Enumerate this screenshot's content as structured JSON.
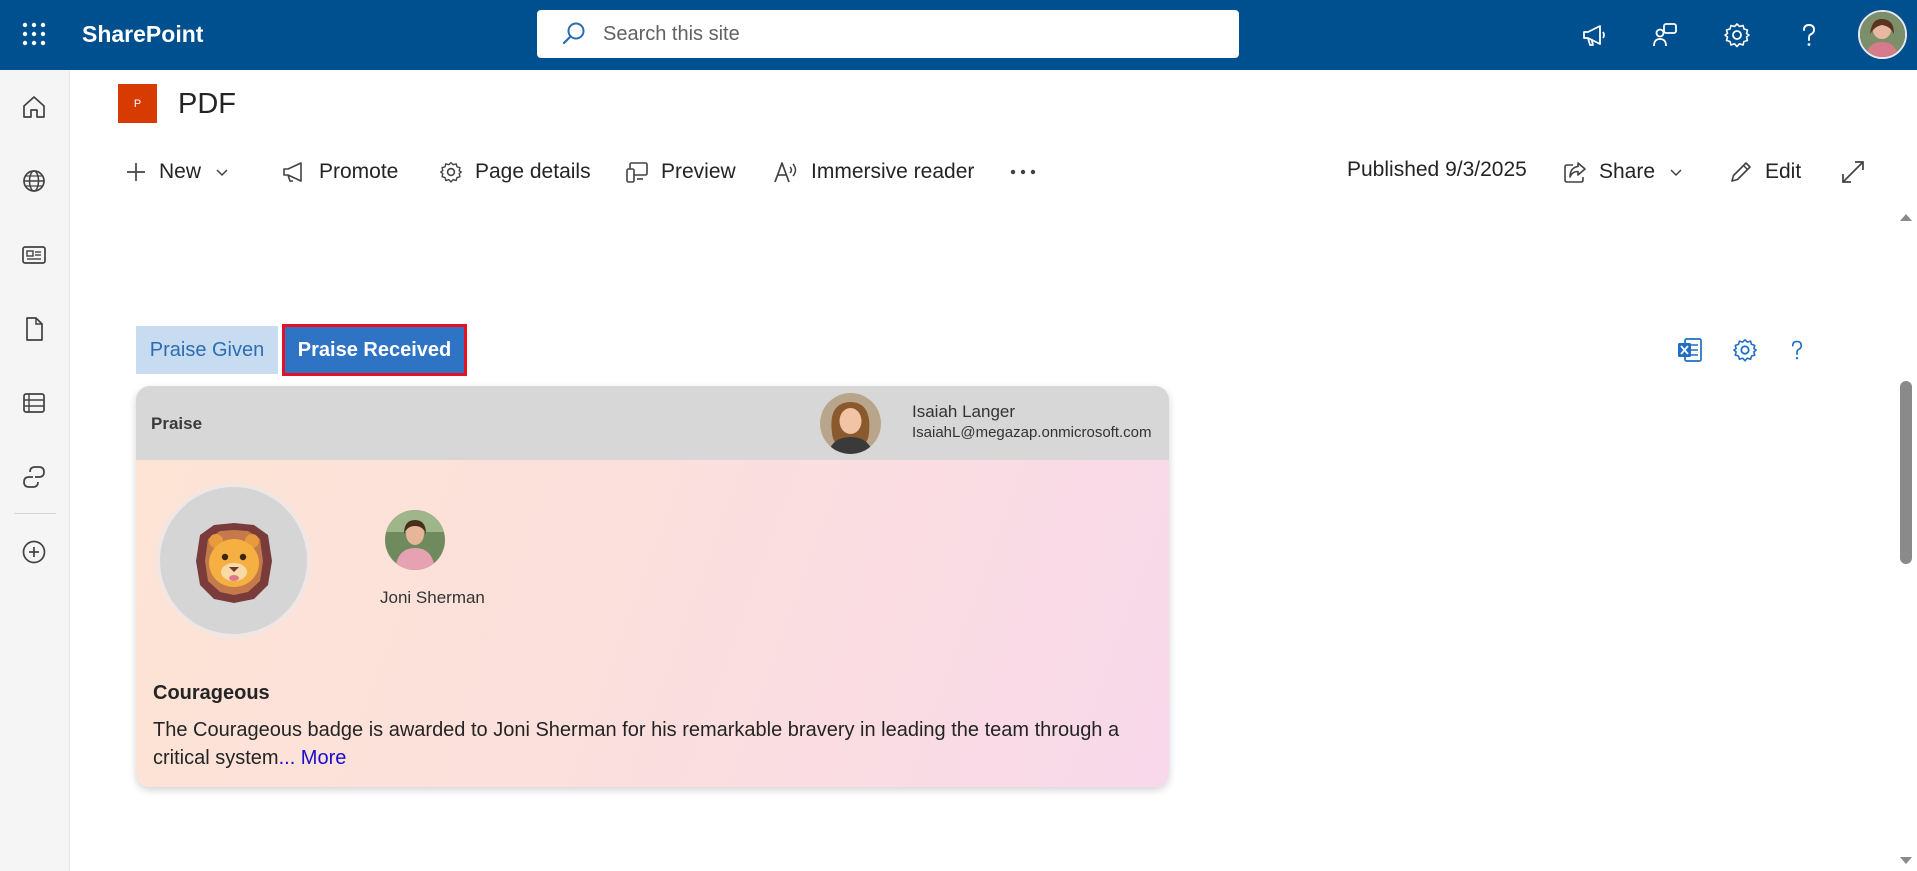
{
  "app": {
    "name": "SharePoint"
  },
  "search": {
    "placeholder": "Search this site"
  },
  "suite_icons": [
    "megaphone-icon",
    "share-feedback-icon",
    "settings-gear-icon",
    "help-question-icon",
    "user-avatar"
  ],
  "rail": {
    "items": [
      "home-icon",
      "globe-sites-icon",
      "news-icon",
      "document-icon",
      "lists-icon",
      "engage-icon",
      "create-plus-icon"
    ]
  },
  "page": {
    "logo_letter": "P",
    "title": "PDF"
  },
  "commands": {
    "new": "New",
    "promote": "Promote",
    "page_details": "Page details",
    "preview": "Preview",
    "immersive_reader": "Immersive reader",
    "more": "...",
    "published": "Published 9/3/2025",
    "share": "Share",
    "edit": "Edit"
  },
  "tabs": {
    "given": "Praise Given",
    "received": "Praise Received",
    "active": "received"
  },
  "tools": [
    "excel-export-icon",
    "settings-gear-icon",
    "help-question-icon"
  ],
  "praise_card": {
    "header_title": "Praise",
    "sender": {
      "name": "Isaiah Langer",
      "email": "IsaiahL@megazap.onmicrosoft.com"
    },
    "badge_icon": "lion-badge-icon",
    "recipient": {
      "name": "Joni Sherman"
    },
    "badge_title": "Courageous",
    "description": "The Courageous badge is awarded to Joni Sherman for his remarkable bravery in leading the team through a critical system",
    "more_label": "... More"
  },
  "colors": {
    "suitebar": "#00508f",
    "tab_active": "#2f74c4",
    "tab_inactive": "#c7dcf0",
    "highlight": "#e81123",
    "page_logo": "#d83b01"
  }
}
